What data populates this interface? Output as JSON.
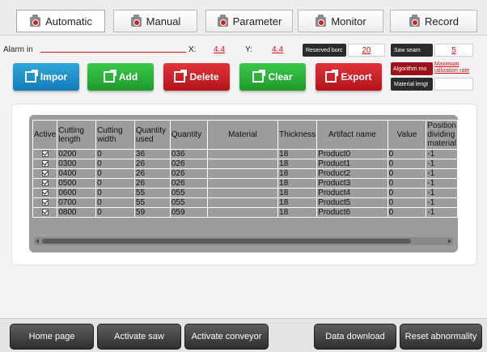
{
  "tabs": [
    {
      "label": "Automatic",
      "icon": "camera-icon",
      "active": true
    },
    {
      "label": "Manual",
      "icon": "camera-icon",
      "active": false
    },
    {
      "label": "Parameter",
      "icon": "camera-icon",
      "active": false
    },
    {
      "label": "Monitor",
      "icon": "camera-icon",
      "active": false
    },
    {
      "label": "Record",
      "icon": "camera-icon",
      "active": false
    }
  ],
  "status": {
    "alarm_label": "Alarm in",
    "x_label": "X:",
    "x_value": "4.4",
    "y_label": "Y:",
    "y_value": "4.4",
    "reserved_label": "Reserved borc",
    "reserved_value": "20",
    "saw_seam_label": "Saw seam",
    "saw_seam_value": "5",
    "algorithm_label": "Algorithm mo",
    "algorithm_value": "Maximum utilization rate",
    "material_length_label": "Material lengt"
  },
  "actions": [
    {
      "label": "Impor",
      "color": "#1f8fc9"
    },
    {
      "label": "Add",
      "color": "#2ab53a"
    },
    {
      "label": "Delete",
      "color": "#c8232a"
    },
    {
      "label": "Clear",
      "color": "#2ab53a"
    },
    {
      "label": "Export",
      "color": "#c8232a"
    }
  ],
  "table": {
    "headers": [
      "Active",
      "Cutting length",
      "Cutting width",
      "Quantity used",
      "Quantity",
      "Material",
      "Thickness",
      "Artifact name",
      "Value",
      "Position dividing material"
    ],
    "rows": [
      {
        "active": true,
        "cutting_length": "0200",
        "cutting_width": "0",
        "quantity_used": "36",
        "quantity": "036",
        "material": "",
        "thickness": "18",
        "artifact_name": "Product0",
        "value": "0",
        "position": "-1"
      },
      {
        "active": true,
        "cutting_length": "0300",
        "cutting_width": "0",
        "quantity_used": "26",
        "quantity": "026",
        "material": "",
        "thickness": "18",
        "artifact_name": "Product1",
        "value": "0",
        "position": "-1"
      },
      {
        "active": true,
        "cutting_length": "0400",
        "cutting_width": "0",
        "quantity_used": "26",
        "quantity": "026",
        "material": "",
        "thickness": "18",
        "artifact_name": "Product2",
        "value": "0",
        "position": "-1"
      },
      {
        "active": true,
        "cutting_length": "0500",
        "cutting_width": "0",
        "quantity_used": "26",
        "quantity": "026",
        "material": "",
        "thickness": "18",
        "artifact_name": "Product3",
        "value": "0",
        "position": "-1"
      },
      {
        "active": true,
        "cutting_length": "0600",
        "cutting_width": "0",
        "quantity_used": "55",
        "quantity": "055",
        "material": "",
        "thickness": "18",
        "artifact_name": "Product4",
        "value": "0",
        "position": "-1"
      },
      {
        "active": true,
        "cutting_length": "0700",
        "cutting_width": "0",
        "quantity_used": "55",
        "quantity": "055",
        "material": "",
        "thickness": "18",
        "artifact_name": "Product5",
        "value": "0",
        "position": "-1"
      },
      {
        "active": true,
        "cutting_length": "0800",
        "cutting_width": "0",
        "quantity_used": "59",
        "quantity": "059",
        "material": "",
        "thickness": "18",
        "artifact_name": "Product6",
        "value": "0",
        "position": "-1"
      }
    ]
  },
  "bottom": [
    {
      "label": "Home page"
    },
    {
      "label": "Activate saw"
    },
    {
      "label": "Activate conveyor"
    },
    {
      "label": "Data download"
    },
    {
      "label": "Reset abnormality"
    }
  ]
}
